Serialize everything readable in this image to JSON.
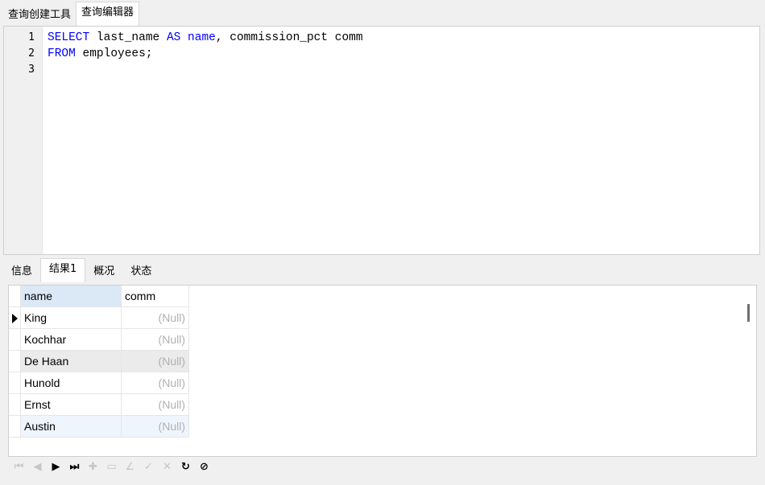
{
  "top_tabs": [
    {
      "label": "查询创建工具"
    },
    {
      "label": "查询编辑器"
    }
  ],
  "editor": {
    "line_numbers": [
      "1",
      "2",
      "3"
    ],
    "lines": [
      {
        "k1": "SELECT",
        "t1": " last_name ",
        "k2": "AS",
        "t2": " ",
        "k3": "name",
        "t3": ", commission_pct comm"
      },
      {
        "k1": "FROM",
        "t1": " employees;"
      },
      {}
    ]
  },
  "bottom_tabs": [
    {
      "label": "信息"
    },
    {
      "label": "结果1"
    },
    {
      "label": "概况"
    },
    {
      "label": "状态"
    }
  ],
  "result": {
    "columns": [
      "name",
      "comm"
    ],
    "rows": [
      [
        "King",
        "(Null)"
      ],
      [
        "Kochhar",
        "(Null)"
      ],
      [
        "De Haan",
        "(Null)"
      ],
      [
        "Hunold",
        "(Null)"
      ],
      [
        "Ernst",
        "(Null)"
      ],
      [
        "Austin",
        "(Null)"
      ]
    ]
  },
  "nav_toolbar": {
    "icons": [
      {
        "name": "first-record-icon",
        "glyph": "⏮",
        "enabled": false
      },
      {
        "name": "prev-record-icon",
        "glyph": "◀",
        "enabled": false
      },
      {
        "name": "next-record-icon",
        "glyph": "▶",
        "enabled": true
      },
      {
        "name": "last-record-icon",
        "glyph": "⏭",
        "enabled": true
      },
      {
        "name": "add-record-icon",
        "glyph": "✚",
        "enabled": false
      },
      {
        "name": "delete-record-icon",
        "glyph": "▭",
        "enabled": false
      },
      {
        "name": "edit-record-icon",
        "glyph": "∠",
        "enabled": false
      },
      {
        "name": "apply-record-icon",
        "glyph": "✓",
        "enabled": false
      },
      {
        "name": "discard-record-icon",
        "glyph": "✕",
        "enabled": false
      },
      {
        "name": "refresh-icon",
        "glyph": "↻",
        "enabled": true
      },
      {
        "name": "stop-icon",
        "glyph": "⊘",
        "enabled": true
      }
    ]
  }
}
